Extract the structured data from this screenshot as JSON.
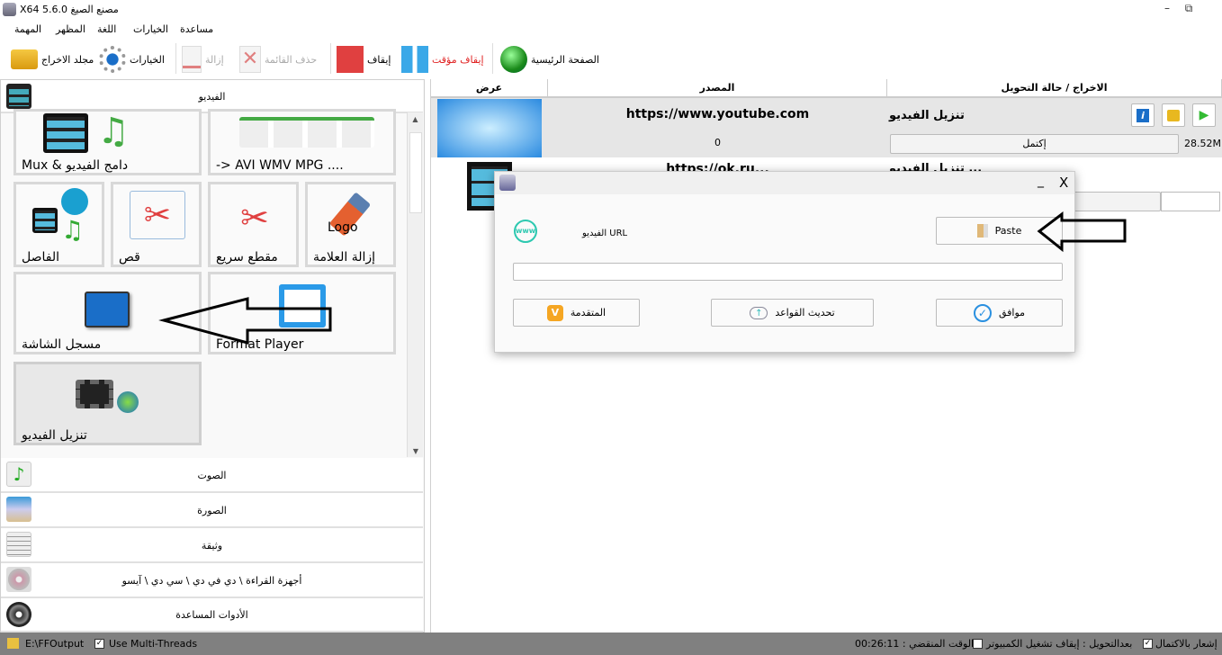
{
  "window": {
    "title": "X64 5.6.0 مصنع الصيغ",
    "minimize": "–",
    "restore": "⧉"
  },
  "menu": [
    "مساعدة",
    "الخيارات",
    "اللغة",
    "المظهر",
    "المهمة"
  ],
  "toolbar": {
    "home": "الصفحة الرئيسية",
    "pause": "إيقاف مؤقت",
    "stop": "إيقاف",
    "clear_list": "حذف القائمة",
    "remove": "إزالة",
    "options": "الخيارات",
    "output_folder": "مجلد الاخراج",
    "pause_color": "#e02020"
  },
  "left": {
    "video_section": "الفيديو",
    "tiles": [
      "Mux & دامج الفيديو",
      "-> AVI WMV MPG ....",
      "الفاصل",
      "قص",
      "مقطع سريع",
      "إزالة العلامة",
      "مسجل الشاشة",
      "Format Player",
      "تنزيل الفيديو"
    ],
    "logo_text": "Logo",
    "sections": [
      "الصوت",
      "الصورة",
      "وثيقة",
      "أجهزة القراءة \\ دي في دي \\ سي دي \\ آيسو",
      "الأدوات المساعدة"
    ]
  },
  "table": {
    "columns": [
      "عرض",
      "المصدر",
      "الاخراج / حالة التحويل"
    ],
    "rows": [
      {
        "source": "https://www.youtube.com",
        "count": "0",
        "task": "تنزيل الفيديو",
        "status": "إكتمل",
        "size": "28.52M"
      },
      {
        "source": "https://ok.ru...",
        "task": "تنزيل الفيديو ..."
      }
    ]
  },
  "dialog": {
    "close": "X",
    "minimize": "_",
    "url_label": "الفيديو URL",
    "paste": "Paste",
    "url_value": "",
    "advanced": "المتقدمة",
    "update_rules": "تحديث القواعد",
    "ok": "موافق",
    "www": "www",
    "v": "V"
  },
  "status": {
    "output_path": "E:\\FFOutput",
    "multithreads": "Use Multi-Threads",
    "notify": "إشعار بالاكتمال",
    "after": "بعدالتحويل : إيقاف تشغيل الكمبيوتر",
    "elapsed": "00:26:11 : الوقت المنقضي",
    "check": "✓"
  }
}
